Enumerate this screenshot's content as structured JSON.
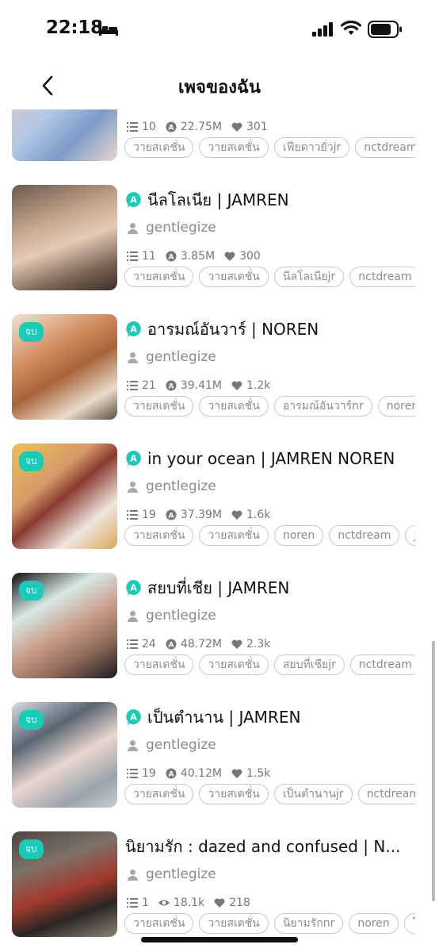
{
  "status": {
    "time": "22:18"
  },
  "nav": {
    "title": "เพจของฉัน"
  },
  "colors": {
    "accent": "#1ec9b5"
  },
  "icons": {
    "chapters": "list-icon",
    "reads": "a-read-icon",
    "views": "eye-icon",
    "likes": "heart-icon",
    "author": "person-icon"
  },
  "stories": [
    {
      "title": "",
      "author": "",
      "chapters": "10",
      "reads": "22.75M",
      "likes": "301",
      "badge_done": "",
      "tags": [
        "วายสเตชั่น",
        "วายสเตชั่น",
        "เฟียดาวยั่วjr",
        "nctdream"
      ]
    },
    {
      "title": "นีลโลเนีย | JAMREN",
      "author": "gentlegize",
      "chapters": "11",
      "reads": "3.85M",
      "likes": "300",
      "badge_done": "",
      "tags": [
        "วายสเตชั่น",
        "วายสเตชั่น",
        "นีลโลเนียjr",
        "nctdream"
      ]
    },
    {
      "title": "อารมณ์อันวาร์ | NOREN",
      "author": "gentlegize",
      "chapters": "21",
      "reads": "39.41M",
      "likes": "1.2k",
      "badge_done": "จบ",
      "tags": [
        "วายสเตชั่น",
        "วายสเตชั่น",
        "อารมณ์อันวาร์nr",
        "noren"
      ]
    },
    {
      "title": "in your ocean | JAMREN NOREN",
      "author": "gentlegize",
      "chapters": "19",
      "reads": "37.39M",
      "likes": "1.6k",
      "badge_done": "จบ",
      "tags": [
        "วายสเตชั่น",
        "วายสเตชั่น",
        "noren",
        "nctdream",
        "JA"
      ]
    },
    {
      "title": "สยบที่เชีย | JAMREN",
      "author": "gentlegize",
      "chapters": "24",
      "reads": "48.72M",
      "likes": "2.3k",
      "badge_done": "จบ",
      "tags": [
        "วายสเตชั่น",
        "วายสเตชั่น",
        "สยบที่เชียjr",
        "nctdream"
      ]
    },
    {
      "title": "เป็นตำนาน | JAMREN",
      "author": "gentlegize",
      "chapters": "19",
      "reads": "40.12M",
      "likes": "1.5k",
      "badge_done": "จบ",
      "tags": [
        "วายสเตชั่น",
        "วายสเตชั่น",
        "เป็นตำนานjr",
        "nctdream"
      ]
    },
    {
      "title": "นิยามรัก : dazed and confused | N...",
      "author": "gentlegize",
      "chapters": "1",
      "reads": "18.1k",
      "likes": "218",
      "badge_done": "จบ",
      "tags": [
        "วายสเตชั่น",
        "วายสเตชั่น",
        "นิยามรักnr",
        "noren",
        "โน"
      ]
    }
  ]
}
